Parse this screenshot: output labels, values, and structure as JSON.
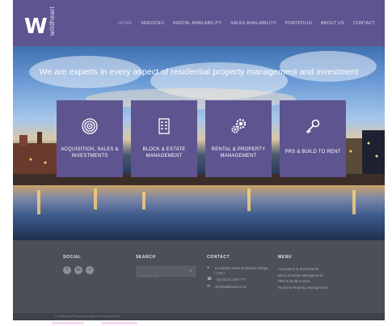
{
  "brand": {
    "logo_letter": "W",
    "logo_word": "wildheart"
  },
  "nav": [
    {
      "label": "HOME",
      "active": true
    },
    {
      "label": "SERVICES"
    },
    {
      "label": "RENTAL AVAILABILITY"
    },
    {
      "label": "SALES AVAILABILITY"
    },
    {
      "label": "PORTFOLIO"
    },
    {
      "label": "ABOUT US"
    },
    {
      "label": "CONTACT"
    }
  ],
  "hero": {
    "tagline": "We are experts in every aspect of residential  property management and investment"
  },
  "cards": [
    {
      "icon": "target-icon",
      "label": "ACQUISITION, SALES & INVESTMENTS"
    },
    {
      "icon": "building-icon",
      "label": "BLOCK & ESTATE MANAGEMENT"
    },
    {
      "icon": "gears-icon",
      "label": "RENTAL & PROPERTY MANAGEMENT"
    },
    {
      "icon": "key-icon",
      "label": "PRS & BUILD TO RENT"
    }
  ],
  "footer": {
    "social": {
      "heading": "SOCIAL",
      "icons": [
        "f",
        "in",
        "t"
      ]
    },
    "search": {
      "heading": "SEARCH",
      "placeholder": "Search site"
    },
    "contact": {
      "heading": "CONTACT",
      "address": "10 Stanley Street Brunswick Village, L3 5TJ",
      "phone": "+44 (0)151 348 7777",
      "email": "info@wildheart.co.uk"
    },
    "menu": {
      "heading": "MENU",
      "items": [
        "Acquisition & Investments",
        "Block & Estate Management",
        "PRS & Build to Rent",
        "Rental & Property Management"
      ]
    }
  },
  "copyright": "© Wildheart Property Management Limited 2016",
  "colors": {
    "purple": "#5e5590",
    "footer": "#4c4f58"
  }
}
